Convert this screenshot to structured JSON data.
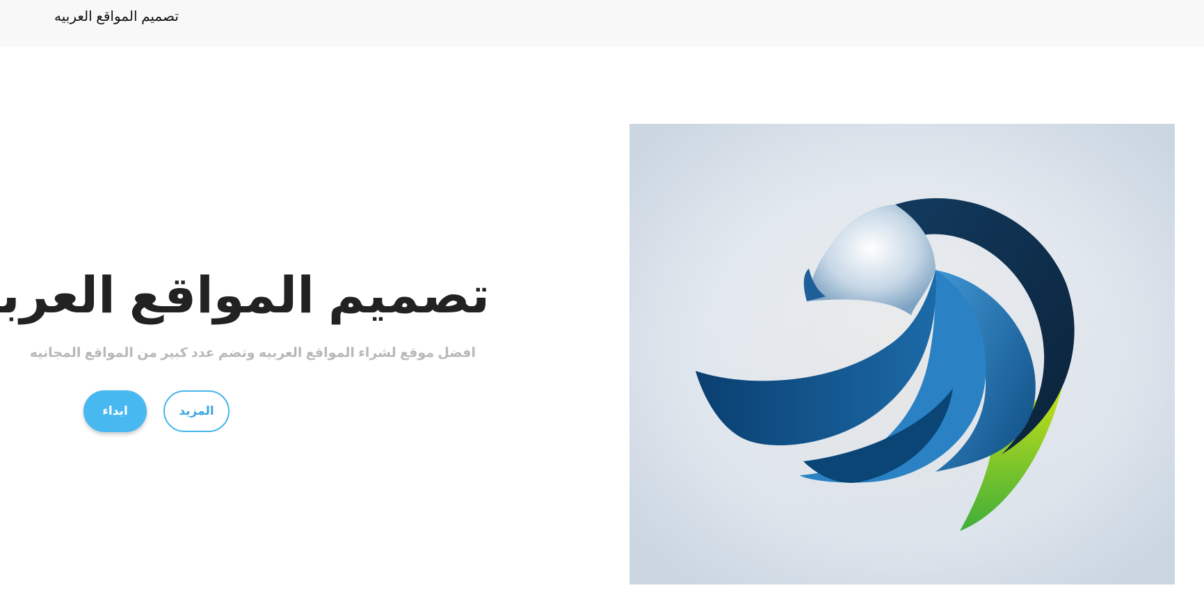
{
  "navbar": {
    "brand": "تصميم المواقع العربيه"
  },
  "hero": {
    "title": "تصميم المواقع العربيه",
    "subtitle": "افضل موقع لشراء المواقع العربيه وتضم عدد كبير من المواقع المجانيه",
    "buttons": {
      "start_label": "ابداء",
      "more_label": "المزيد"
    },
    "image": {
      "icon": "bird-logo-icon"
    }
  },
  "colors": {
    "navbar_bg": "#f8f8f8",
    "accent": "#47b8f0",
    "title": "#222222",
    "subtitle": "#b8b8b8",
    "logo_dark_blue": "#0a3d6b",
    "logo_blue": "#2f8fd0",
    "logo_green": "#8cc63f"
  }
}
